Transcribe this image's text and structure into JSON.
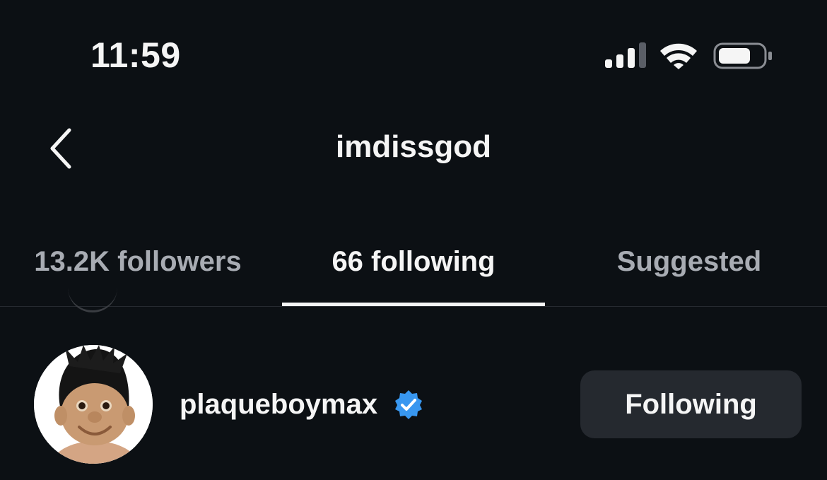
{
  "status_bar": {
    "time": "11:59",
    "icons": [
      "cellular-signal-icon",
      "wifi-icon",
      "battery-icon"
    ]
  },
  "header": {
    "back_icon": "chevron-left-icon",
    "title": "imdissgod"
  },
  "tabs": [
    {
      "label": "13.2K followers",
      "active": false
    },
    {
      "label": "66 following",
      "active": true
    },
    {
      "label": "Suggested",
      "active": false
    }
  ],
  "list": [
    {
      "username": "plaqueboymax",
      "verified": true,
      "button_label": "Following"
    }
  ],
  "colors": {
    "background": "#0c1014",
    "text": "#f5f5f5",
    "muted_text": "#a8acb3",
    "button_bg": "#25292f",
    "verified_blue": "#3897f0"
  }
}
